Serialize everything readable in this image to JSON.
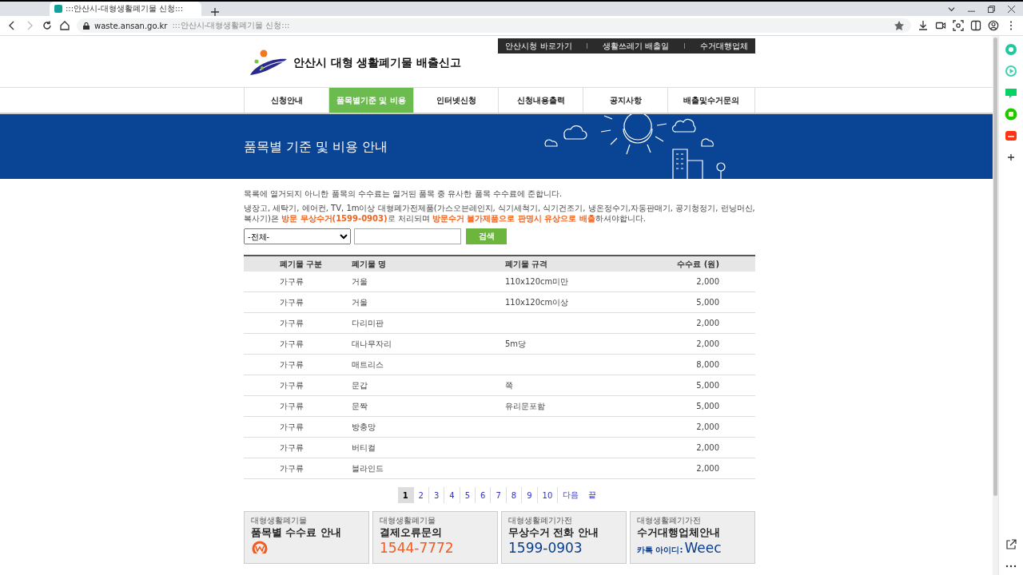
{
  "browser": {
    "tabs": [
      {
        "title": ":::안산시-대형생활폐기물 신청:::",
        "selected": true
      }
    ],
    "address": {
      "domain": "waste.ansan.go.kr",
      "title": ":::안산시-대형생활폐기물 신청:::"
    }
  },
  "site": {
    "top_links": [
      "안산시청 바로가기",
      "생활쓰레기 배출일",
      "수거대행업체"
    ],
    "logo_text": "안산시 대형 생활폐기물 배출신고",
    "nav": [
      {
        "label": "신청안내",
        "selected": false
      },
      {
        "label": "품목별기준 및 비용",
        "selected": true
      },
      {
        "label": "인터넷신청",
        "selected": false
      },
      {
        "label": "신청내용출력",
        "selected": false
      },
      {
        "label": "공지사항",
        "selected": false
      },
      {
        "label": "배출및수거문의",
        "selected": false
      }
    ],
    "banner_title": "품목별 기준 및 비용 안내",
    "notices": [
      "목록에 열거되지 아니한 품목의 수수료는 열거된 품목 중 유사한 품목 수수료에 준합니다.",
      "냉장고, 세탁기, 에어컨, TV, 1m이상 대형폐가전제품(가스오븐레인지, 식기세척기, 식기건조기, 냉온정수기,자동판매기, 공기청정기, 런닝머신, 복사기)은 **방문 무상수거(1599-0903)**로 처리되며 **방문수거 불가제품으로 판명시 유상으로 배출**하셔야합니다."
    ],
    "search": {
      "select": "-전체-",
      "button": "검색"
    },
    "table": {
      "columns": [
        "폐기물 구분",
        "폐기물 명",
        "폐기물 규격",
        "수수료 (원)"
      ],
      "rows": [
        [
          "가구류",
          "거울",
          "110x120cm미만",
          "2,000"
        ],
        [
          "가구류",
          "거울",
          "110x120cm이상",
          "5,000"
        ],
        [
          "가구류",
          "다리미판",
          "",
          "2,000"
        ],
        [
          "가구류",
          "대나무자리",
          "5m당",
          "2,000"
        ],
        [
          "가구류",
          "매트리스",
          "",
          "8,000"
        ],
        [
          "가구류",
          "문갑",
          "쪽",
          "5,000"
        ],
        [
          "가구류",
          "문짝",
          "유리문포함",
          "5,000"
        ],
        [
          "가구류",
          "방충망",
          "",
          "2,000"
        ],
        [
          "가구류",
          "버티컬",
          "",
          "2,000"
        ],
        [
          "가구류",
          "블라인드",
          "",
          "2,000"
        ]
      ]
    },
    "pagination": {
      "pages": [
        {
          "label": "1",
          "selected": true
        },
        {
          "label": "2",
          "selected": false
        },
        {
          "label": "3",
          "selected": false
        },
        {
          "label": "4",
          "selected": false
        },
        {
          "label": "5",
          "selected": false
        },
        {
          "label": "6",
          "selected": false
        },
        {
          "label": "7",
          "selected": false
        },
        {
          "label": "8",
          "selected": false
        },
        {
          "label": "9",
          "selected": false
        },
        {
          "label": "10",
          "selected": false
        }
      ],
      "next": "다음",
      "last": "끝"
    },
    "cards": [
      {
        "category": "대형생활폐기물",
        "title": "품목별 수수료 안내",
        "kind": "icon",
        "color": "#f05a22"
      },
      {
        "category": "대형생활폐기물",
        "title": "결제오류문의",
        "kind": "phone",
        "value": "1544-7772",
        "color": "#f05a22"
      },
      {
        "category": "대형생활폐기가전",
        "title": "무상수거 전화 안내",
        "kind": "phone",
        "value": "1599-0903",
        "color": "#0a3d8c"
      },
      {
        "category": "대형생활폐기가전",
        "title": "수거대행업체안내",
        "kind": "kakao",
        "label": "카톡 아이디:",
        "value": "Weec",
        "color": "#0a3d8c"
      }
    ]
  }
}
